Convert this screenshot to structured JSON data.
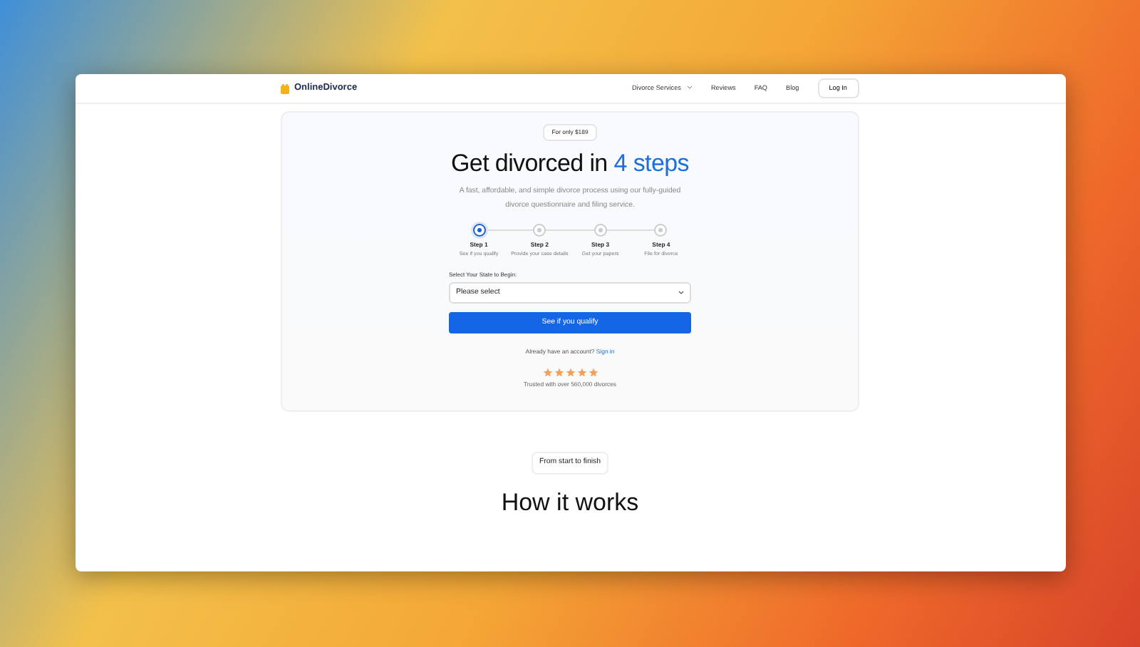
{
  "site": {
    "logo": "OnlineDivorce",
    "nav": [
      {
        "label": "Divorce Services",
        "dropdown": true
      },
      {
        "label": "Reviews",
        "dropdown": false
      },
      {
        "label": "FAQ",
        "dropdown": false
      },
      {
        "label": "Blog",
        "dropdown": false
      }
    ],
    "login": "Log In"
  },
  "hero": {
    "badge": "For only $189",
    "title": "Get divorced in **4 steps**",
    "subtitle": "A fast, affordable, and simple divorce process using our fully-guided divorce questionnaire and filing service.",
    "steps": [
      {
        "title": "Step 1",
        "caption": "See if you qualify",
        "selected": true
      },
      {
        "title": "Step 2",
        "caption": "Provide your case details",
        "selected": false
      },
      {
        "title": "Step 3",
        "caption": "Get your papers",
        "selected": false
      },
      {
        "title": "Step 4",
        "caption": "File for divorce",
        "selected": false
      }
    ],
    "state_label": "Select Your State to Begin:",
    "state_select": {
      "value": "Please select"
    },
    "cta": "See if you qualify",
    "account_prompt": "Already have an account?",
    "sign_in": "Sign in",
    "rating": {
      "stars": 5
    },
    "trust": "Trusted with over 560,000 divorces"
  },
  "section": {
    "badge": "From start to finish",
    "title": "How it works"
  }
}
